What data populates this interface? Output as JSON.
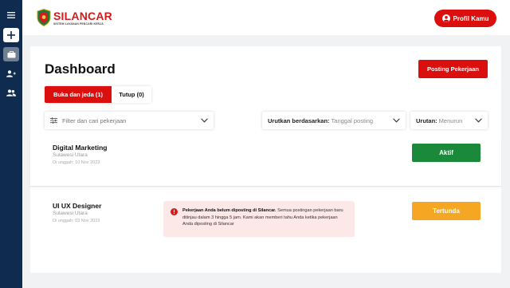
{
  "sidebar": {
    "items": [
      {
        "icon": "menu-icon"
      },
      {
        "icon": "plus-icon"
      },
      {
        "icon": "briefcase-icon"
      },
      {
        "icon": "add-user-icon"
      },
      {
        "icon": "users-icon"
      }
    ]
  },
  "header": {
    "logo_prefix": "SI",
    "logo_rest": "LANCAR",
    "logo_subtitle": "SISTEM LAYANAN PENCARI KERJA",
    "profile_label": "Profil Kamu"
  },
  "main": {
    "title": "Dashboard",
    "post_button": "Posting Pekerjaan",
    "tabs": [
      {
        "label": "Buka dan jeda (1)",
        "active": true
      },
      {
        "label": "Tutup (0)",
        "active": false
      }
    ],
    "filter_placeholder": "Filter dan cari pekerjaan",
    "sort_label": "Urutkan berdasarkan:",
    "sort_value": "Tanggal posting",
    "order_label": "Urutan:",
    "order_value": "Menurun"
  },
  "jobs": [
    {
      "title": "Digital Marketing",
      "location": "Sulawesi Utara",
      "date": "Di unggah: 10 Nov 2023",
      "status": "Aktif"
    },
    {
      "title": "UI UX Designer",
      "location": "Sulawesi Utara",
      "date": "Di unggah: 03 Nov 2023",
      "status": "Tertunda",
      "alert_bold": "Pekerjaan Anda belum diposting di Silancar.",
      "alert_text": " Semua postingan pekerjaan baru ditinjau dalam 3 hingga 5 jam. Kami akan memberi tahu Anda ketika pekerjaan Anda diposting di Silancar"
    }
  ],
  "colors": {
    "brand_red": "#dc0f0f",
    "sidebar_navy": "#0f2b4f",
    "active_green": "#1a8a3a",
    "pending_orange": "#f5a623",
    "alert_bg": "#fde8e8"
  }
}
